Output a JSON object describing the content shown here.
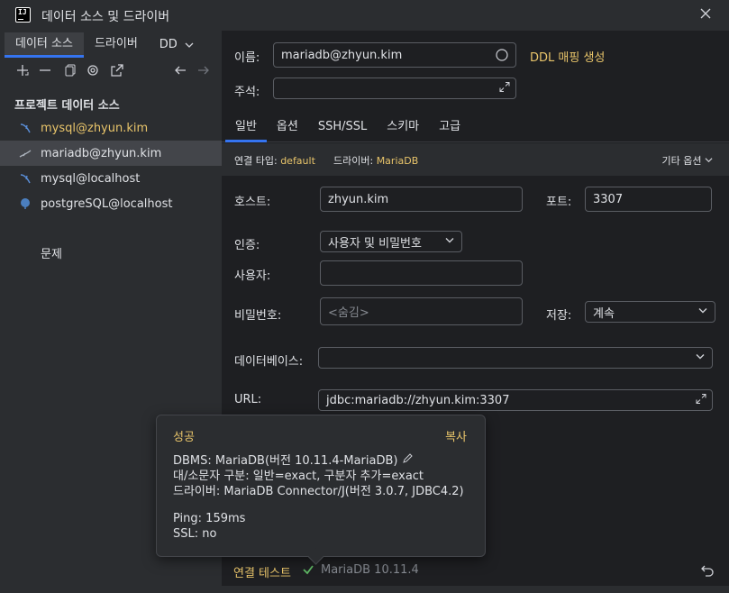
{
  "window": {
    "title": "데이터 소스 및 드라이버",
    "app_icon_text": "IJ"
  },
  "left": {
    "tabs": [
      {
        "label": "데이터 소스"
      },
      {
        "label": "드라이버"
      },
      {
        "label": "DD"
      }
    ],
    "toolbar_icons": [
      "add-icon",
      "remove-icon",
      "duplicate-icon",
      "settings-icon",
      "navigate-icon",
      "back-arrow-icon",
      "forward-arrow-icon"
    ],
    "section_title": "프로젝트 데이터 소스",
    "items": [
      {
        "label": "mysql@zhyun.kim",
        "icon": "mysql-icon",
        "highlight": true
      },
      {
        "label": "mariadb@zhyun.kim",
        "icon": "mariadb-icon",
        "selected": true
      },
      {
        "label": "mysql@localhost",
        "icon": "mysql-icon"
      },
      {
        "label": "postgreSQL@localhost",
        "icon": "postgresql-icon"
      }
    ],
    "problems": "문제"
  },
  "form": {
    "name_label": "이름:",
    "name_value": "mariadb@zhyun.kim",
    "ddl_link": "DDL 매핑 생성",
    "comment_label": "주석:",
    "comment_value": "",
    "tabs": [
      "일반",
      "옵션",
      "SSH/SSL",
      "스키마",
      "고급"
    ],
    "conn_type_label": "연결 타입:",
    "conn_type_value": "default",
    "driver_label": "드라이버:",
    "driver_value": "MariaDB",
    "other_options": "기타 옵션",
    "host_label": "호스트:",
    "host_value": "zhyun.kim",
    "port_label": "포트:",
    "port_value": "3307",
    "auth_label": "인증:",
    "auth_value": "사용자 및 비밀번호",
    "user_label": "사용자:",
    "user_value": "",
    "password_label": "비밀번호:",
    "password_placeholder": "<숨김>",
    "save_label": "저장:",
    "save_value": "계속",
    "database_label": "데이터베이스:",
    "database_value": "",
    "url_label": "URL:",
    "url_value": "jdbc:mariadb://zhyun.kim:3307"
  },
  "popup": {
    "title": "성공",
    "copy": "복사",
    "dbms": "DBMS: MariaDB(버전 10.11.4-MariaDB)",
    "case": "대/소문자 구분: 일반=exact, 구분자 추가=exact",
    "driver": "드라이버: MariaDB Connector/J(버전 3.0.7, JDBC4.2)",
    "ping": "Ping: 159ms",
    "ssl": "SSL: no"
  },
  "bottom": {
    "test_connection": "연결 테스트",
    "test_result": "MariaDB 10.11.4"
  },
  "colors": {
    "accent": "#3574f0",
    "link": "#e8c46a",
    "success": "#5fb865"
  }
}
